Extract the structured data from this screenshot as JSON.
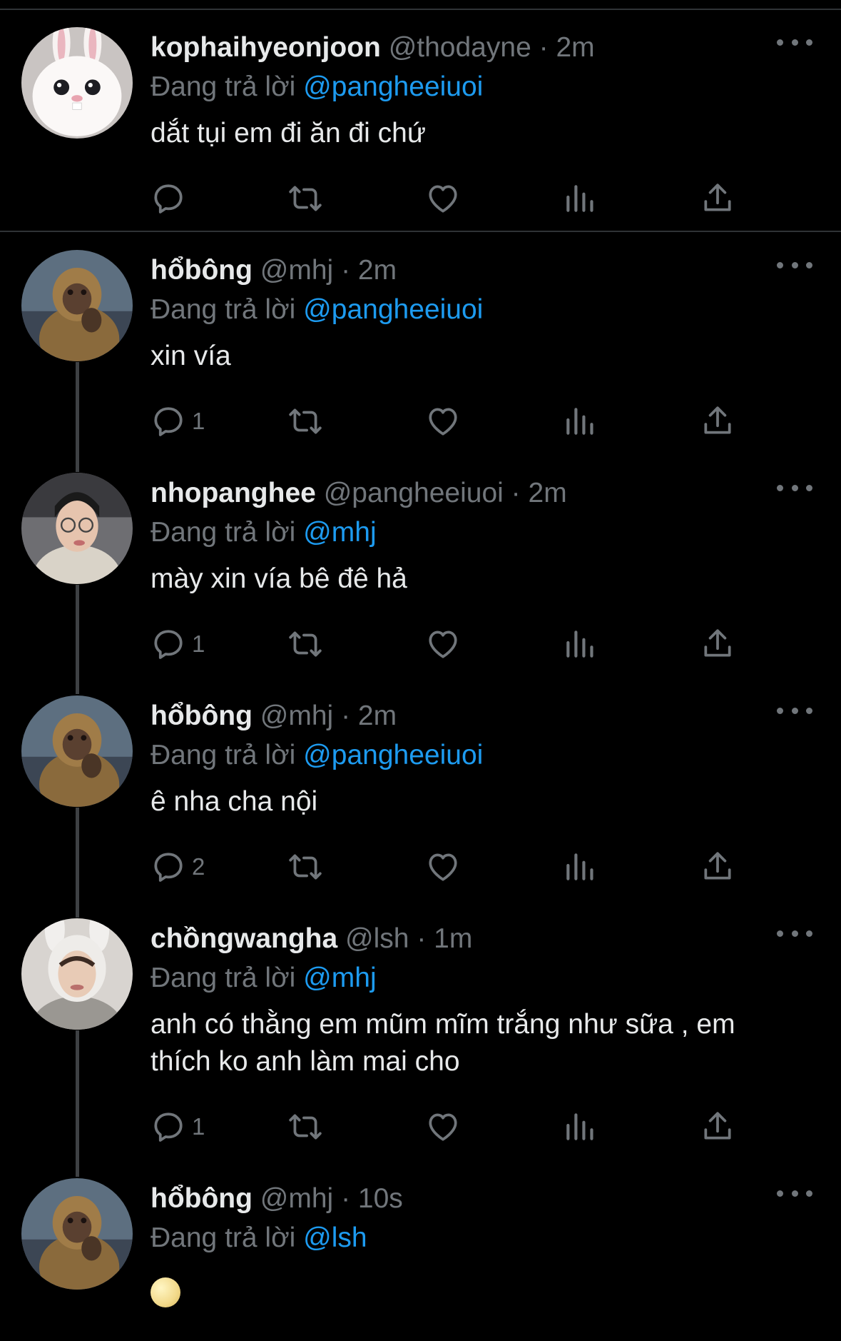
{
  "reply_prefix": "Đang trả lời",
  "tweets": [
    {
      "name": "kophaihyeonjoon",
      "handle": "@thodayne",
      "dot": "·",
      "time": "2m",
      "reply_to": "@pangheeiuoi",
      "text": "dắt tụi em đi ăn đi chứ",
      "reply_count": "",
      "avatar": "white-rabbit-avatar"
    },
    {
      "name": "hổbông",
      "handle": "@mhj",
      "dot": "·",
      "time": "2m",
      "reply_to": "@pangheeiuoi",
      "text": "xin vía",
      "reply_count": "1",
      "avatar": "monkey-avatar"
    },
    {
      "name": "nhopanghee",
      "handle": "@pangheeiuoi",
      "dot": "·",
      "time": "2m",
      "reply_to": "@mhj",
      "text": "mày xin vía bê đê hả",
      "reply_count": "1",
      "avatar": "person-glasses-avatar"
    },
    {
      "name": "hổbông",
      "handle": "@mhj",
      "dot": "·",
      "time": "2m",
      "reply_to": "@pangheeiuoi",
      "text": "ê nha cha nội",
      "reply_count": "2",
      "avatar": "monkey-avatar"
    },
    {
      "name": "chồngwangha",
      "handle": "@lsh",
      "dot": "·",
      "time": "1m",
      "reply_to": "@mhj",
      "text_line1": "anh có thằng em mũm mĩm trắng như sữa , em",
      "text_line2": "thích ko anh làm mai cho",
      "reply_count": "1",
      "avatar": "person-bunny-hat-avatar"
    },
    {
      "name": "hổbông",
      "handle": "@mhj",
      "dot": "·",
      "time": "10s",
      "reply_to": "@lsh",
      "emoji": "moon-face-emoji",
      "avatar": "monkey-avatar"
    }
  ],
  "colors": {
    "background": "#000000",
    "text": "#e7e9ea",
    "muted": "#71767b",
    "mention": "#1d9bf0",
    "divider": "#2f3336"
  }
}
